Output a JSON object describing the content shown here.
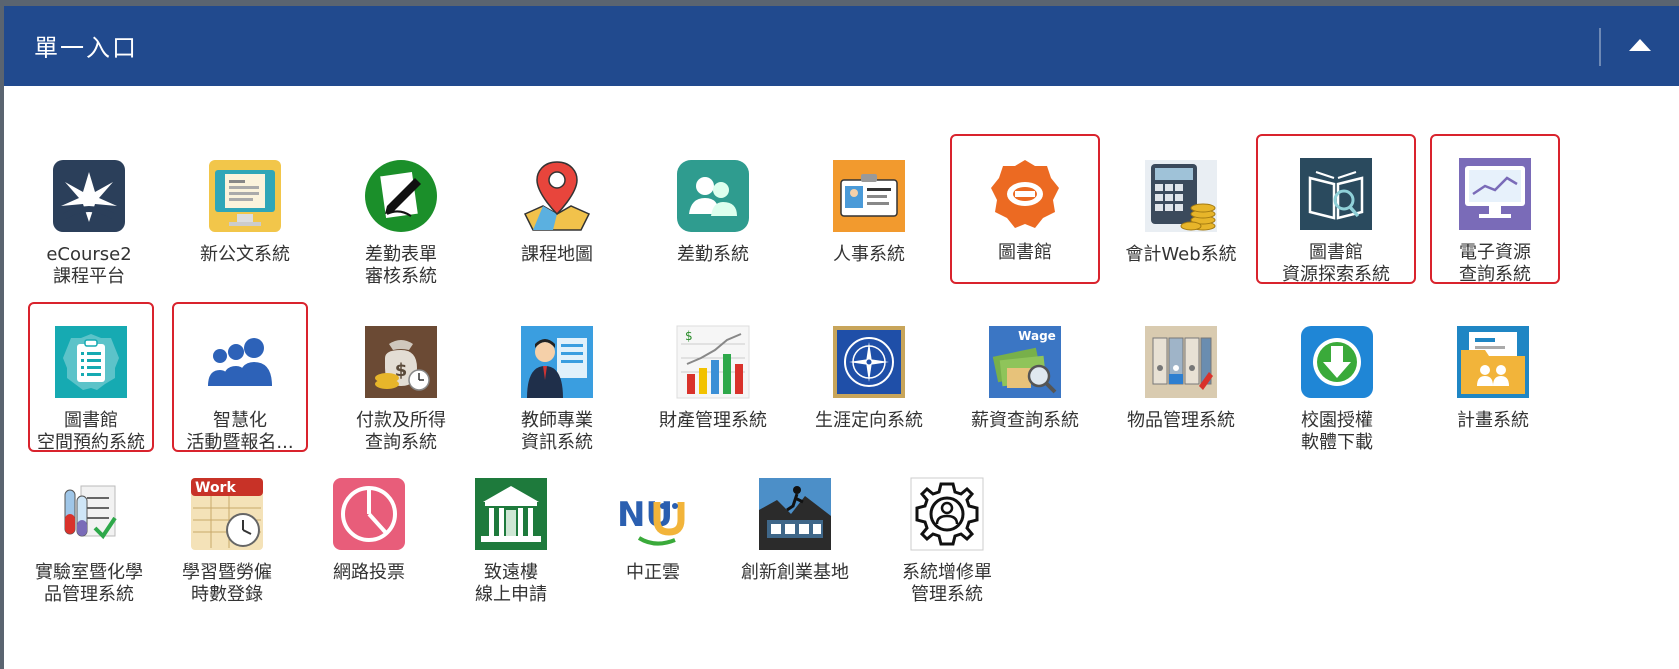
{
  "header": {
    "title": "單一入口"
  },
  "colors": {
    "header_bg": "#214a8e",
    "highlight_border": "#d9232d"
  },
  "tiles": [
    {
      "label": "eCourse2\n課程平台",
      "icon": "ecourse-icon",
      "highlighted": false
    },
    {
      "label": "新公文系統",
      "icon": "document-monitor-icon",
      "highlighted": false
    },
    {
      "label": "差勤表單\n審核系統",
      "icon": "pen-sign-icon",
      "highlighted": false
    },
    {
      "label": "課程地圖",
      "icon": "map-pin-icon",
      "highlighted": false
    },
    {
      "label": "差勤系統",
      "icon": "people-icon",
      "highlighted": false
    },
    {
      "label": "人事系統",
      "icon": "id-card-icon",
      "highlighted": false
    },
    {
      "label": "圖書館",
      "icon": "library-badge-icon",
      "highlighted": true
    },
    {
      "label": "會計Web系統",
      "icon": "calculator-coins-icon",
      "highlighted": false
    },
    {
      "label": "圖書館\n資源探索系統",
      "icon": "book-search-icon",
      "highlighted": true
    },
    {
      "label": "電子資源\n查詢系統",
      "icon": "monitor-chart-icon",
      "highlighted": true
    },
    {
      "label": "圖書館\n空間預約系統",
      "icon": "clipboard-list-icon",
      "highlighted": true
    },
    {
      "label": "智慧化\n活動暨報名...",
      "icon": "group-people-icon",
      "highlighted": true
    },
    {
      "label": "付款及所得\n查詢系統",
      "icon": "money-bag-icon",
      "highlighted": false
    },
    {
      "label": "教師專業\n資訊系統",
      "icon": "teacher-profile-icon",
      "highlighted": false
    },
    {
      "label": "財產管理系統",
      "icon": "bar-chart-icon",
      "highlighted": false
    },
    {
      "label": "生涯定向系統",
      "icon": "compass-icon",
      "highlighted": false
    },
    {
      "label": "薪資查詢系統",
      "icon": "wage-icon",
      "highlighted": false
    },
    {
      "label": "物品管理系統",
      "icon": "binders-icon",
      "highlighted": false
    },
    {
      "label": "校園授權\n軟體下載",
      "icon": "download-icon",
      "highlighted": false
    },
    {
      "label": "計畫系統",
      "icon": "folder-people-icon",
      "highlighted": false
    },
    {
      "label": "實驗室暨化學\n品管理系統",
      "icon": "lab-tubes-icon",
      "highlighted": false
    },
    {
      "label": "學習暨勞僱\n時數登錄",
      "icon": "work-clock-icon",
      "highlighted": false
    },
    {
      "label": "網路投票",
      "icon": "vote-pie-icon",
      "highlighted": false
    },
    {
      "label": "致遠樓\n線上申請",
      "icon": "building-icon",
      "highlighted": false
    },
    {
      "label": "中正雲",
      "icon": "nu-cloud-icon",
      "highlighted": false
    },
    {
      "label": "創新創業基地",
      "icon": "climber-icon",
      "highlighted": false
    },
    {
      "label": "系統增修單\n管理系統",
      "icon": "gear-person-icon",
      "highlighted": false
    }
  ],
  "icon_text": {
    "wage": "Wage",
    "work": "Work",
    "nu": "NU"
  }
}
